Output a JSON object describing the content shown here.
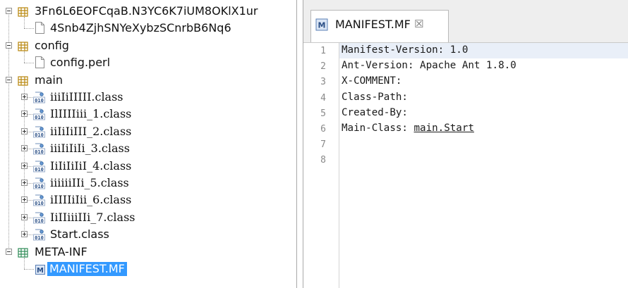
{
  "tree": {
    "nodes": [
      {
        "label": "3Fn6L6EOFCqaB.N3YC6K7iUM8OKlX1ur",
        "type": "package",
        "expanded": true
      },
      {
        "label": "4Snb4ZjhSNYeXybzSCnrbB6Nq6",
        "type": "file"
      },
      {
        "label": "config",
        "type": "package",
        "expanded": true
      },
      {
        "label": "config.perl",
        "type": "file"
      },
      {
        "label": "main",
        "type": "package",
        "expanded": true
      },
      {
        "label": "iiiIiIIIII.class",
        "type": "class"
      },
      {
        "label": "IlIIIIiii_1.class",
        "type": "class"
      },
      {
        "label": "iiIiIiIII_2.class",
        "type": "class"
      },
      {
        "label": "iiiIiIiIi_3.class",
        "type": "class"
      },
      {
        "label": "IiIiIiIiI_4.class",
        "type": "class"
      },
      {
        "label": "iiiiiiIIi_5.class",
        "type": "class"
      },
      {
        "label": "iIIIIiIii_6.class",
        "type": "class"
      },
      {
        "label": "IiIIiiiIIi_7.class",
        "type": "class"
      },
      {
        "label": "Start.class",
        "type": "class"
      },
      {
        "label": "META-INF",
        "type": "package",
        "expanded": true
      },
      {
        "label": "MANIFEST.MF",
        "type": "manifest",
        "selected": true
      }
    ]
  },
  "editor": {
    "tab_title": "MANIFEST.MF",
    "tab_close_glyph": "☒",
    "lines": [
      {
        "num": "1",
        "text": "Manifest-Version: 1.0",
        "link": ""
      },
      {
        "num": "2",
        "text": "Ant-Version: Apache Ant 1.8.0",
        "link": ""
      },
      {
        "num": "3",
        "text": "X-COMMENT:",
        "link": ""
      },
      {
        "num": "4",
        "text": "Class-Path:",
        "link": ""
      },
      {
        "num": "5",
        "text": "Created-By:",
        "link": ""
      },
      {
        "num": "6",
        "text": "Main-Class: ",
        "link": "main.Start"
      },
      {
        "num": "7",
        "text": "",
        "link": ""
      },
      {
        "num": "8",
        "text": "",
        "link": ""
      }
    ]
  },
  "colors": {
    "selection": "#3399ff",
    "package_icon": "#b8860b",
    "meta_icon": "#2e8b57",
    "class_icon": "#3b6ea5",
    "current_line": "#e9eff8"
  }
}
